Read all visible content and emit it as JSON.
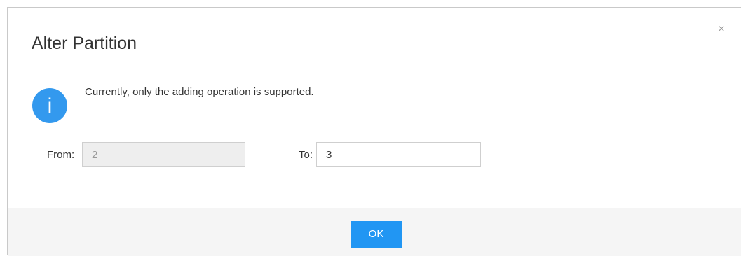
{
  "dialog": {
    "title": "Alter Partition",
    "close_symbol": "×",
    "info_icon": "info-icon",
    "info_glyph": "i",
    "message": "Currently, only the adding operation is supported.",
    "from": {
      "label": "From:",
      "value": "2"
    },
    "to": {
      "label": "To:",
      "value": "3"
    },
    "ok_label": "OK"
  },
  "colors": {
    "accent": "#2196f3",
    "info_icon": "#3399ee",
    "footer_background": "#f5f5f5",
    "disabled_input_background": "#eeeeee"
  }
}
